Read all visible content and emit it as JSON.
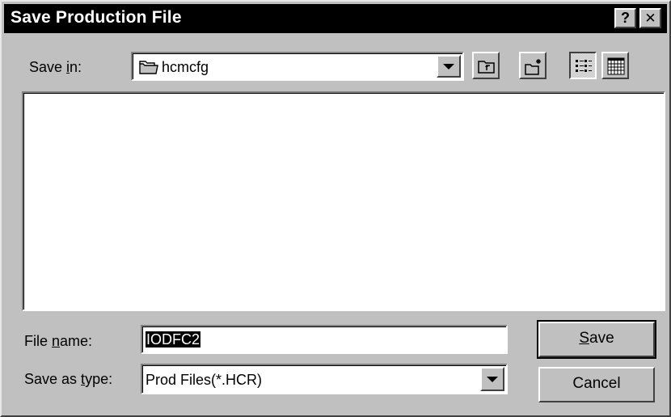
{
  "window": {
    "title": "Save Production File",
    "help_label": "?",
    "close_label": "✕"
  },
  "save_in": {
    "label_pre": "Save ",
    "label_underline": "i",
    "label_post": "n:",
    "value": "hcmcfg",
    "icon": "folder-icon"
  },
  "toolbar": {
    "up_folder_icon": "up-one-level-icon",
    "new_folder_icon": "create-new-folder-icon",
    "list_view_icon": "list-view-icon",
    "details_view_icon": "details-view-icon"
  },
  "file_name": {
    "label_pre": "File ",
    "label_underline": "n",
    "label_post": "ame:",
    "value": "IODFC2"
  },
  "save_as_type": {
    "label_pre": "Save as ",
    "label_underline": "t",
    "label_post": "ype:",
    "value": "Prod Files(*.HCR)"
  },
  "buttons": {
    "save_underline": "S",
    "save_rest": "ave",
    "cancel": "Cancel"
  }
}
